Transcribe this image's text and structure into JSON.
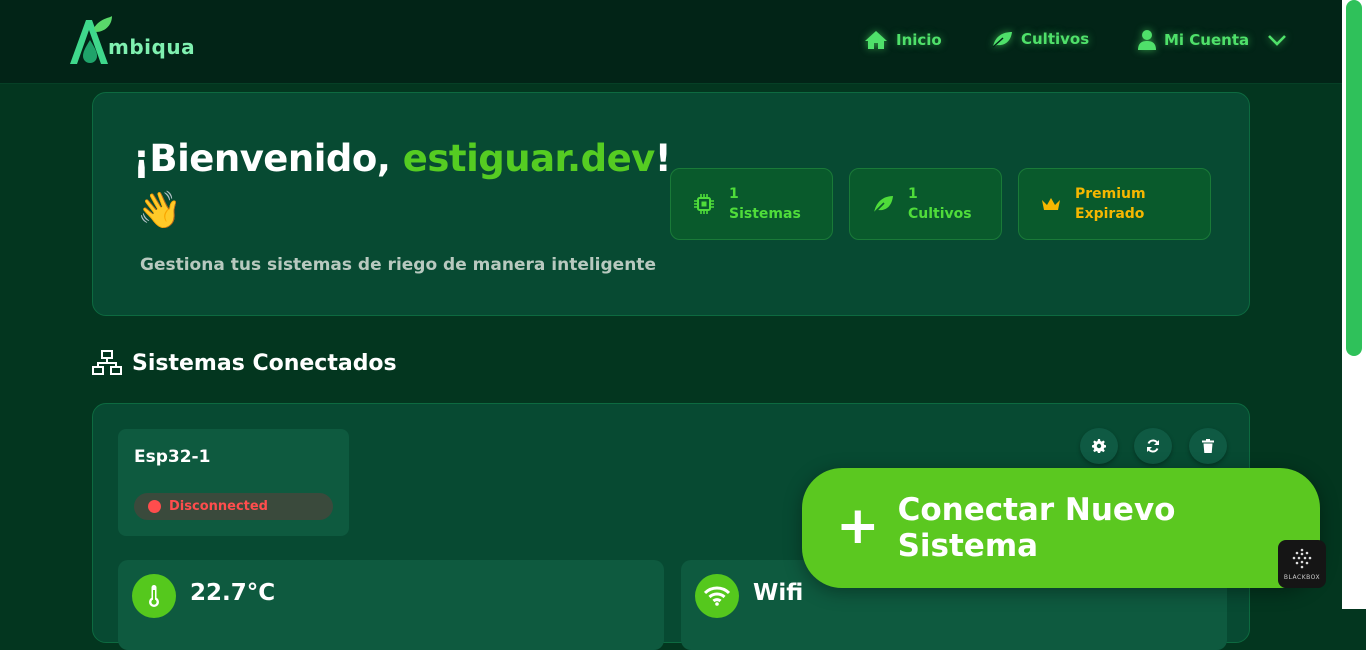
{
  "brand": {
    "name": "mbiqua"
  },
  "nav": {
    "inicio": "Inicio",
    "cultivos": "Cultivos",
    "cuenta": "Mi Cuenta"
  },
  "welcome": {
    "greeting": "¡Bienvenido, ",
    "username": "estiguar.dev",
    "bang": "!",
    "wave": "👋",
    "subtitle": "Gestiona tus sistemas de riego de manera inteligente"
  },
  "stats": [
    {
      "line1": "1",
      "line2": "Sistemas",
      "icon": "chip-icon"
    },
    {
      "line1": "1",
      "line2": "Cultivos",
      "icon": "leaf-icon"
    },
    {
      "line1": "Premium",
      "line2": "Expirado",
      "icon": "crown-icon",
      "color": "#f5b700"
    }
  ],
  "section": {
    "title": "Sistemas Conectados"
  },
  "device": {
    "name": "Esp32-1",
    "status": "Disconnected",
    "status_color": "#ff4d4d",
    "temperature": "22.7°C",
    "connection": "Wifi"
  },
  "fab": {
    "label": "Conectar Nuevo Sistema"
  },
  "widget": {
    "label": "BLACKBOX"
  },
  "colors": {
    "accent": "#55cc22",
    "background": "#03361f",
    "header": "#022417"
  }
}
